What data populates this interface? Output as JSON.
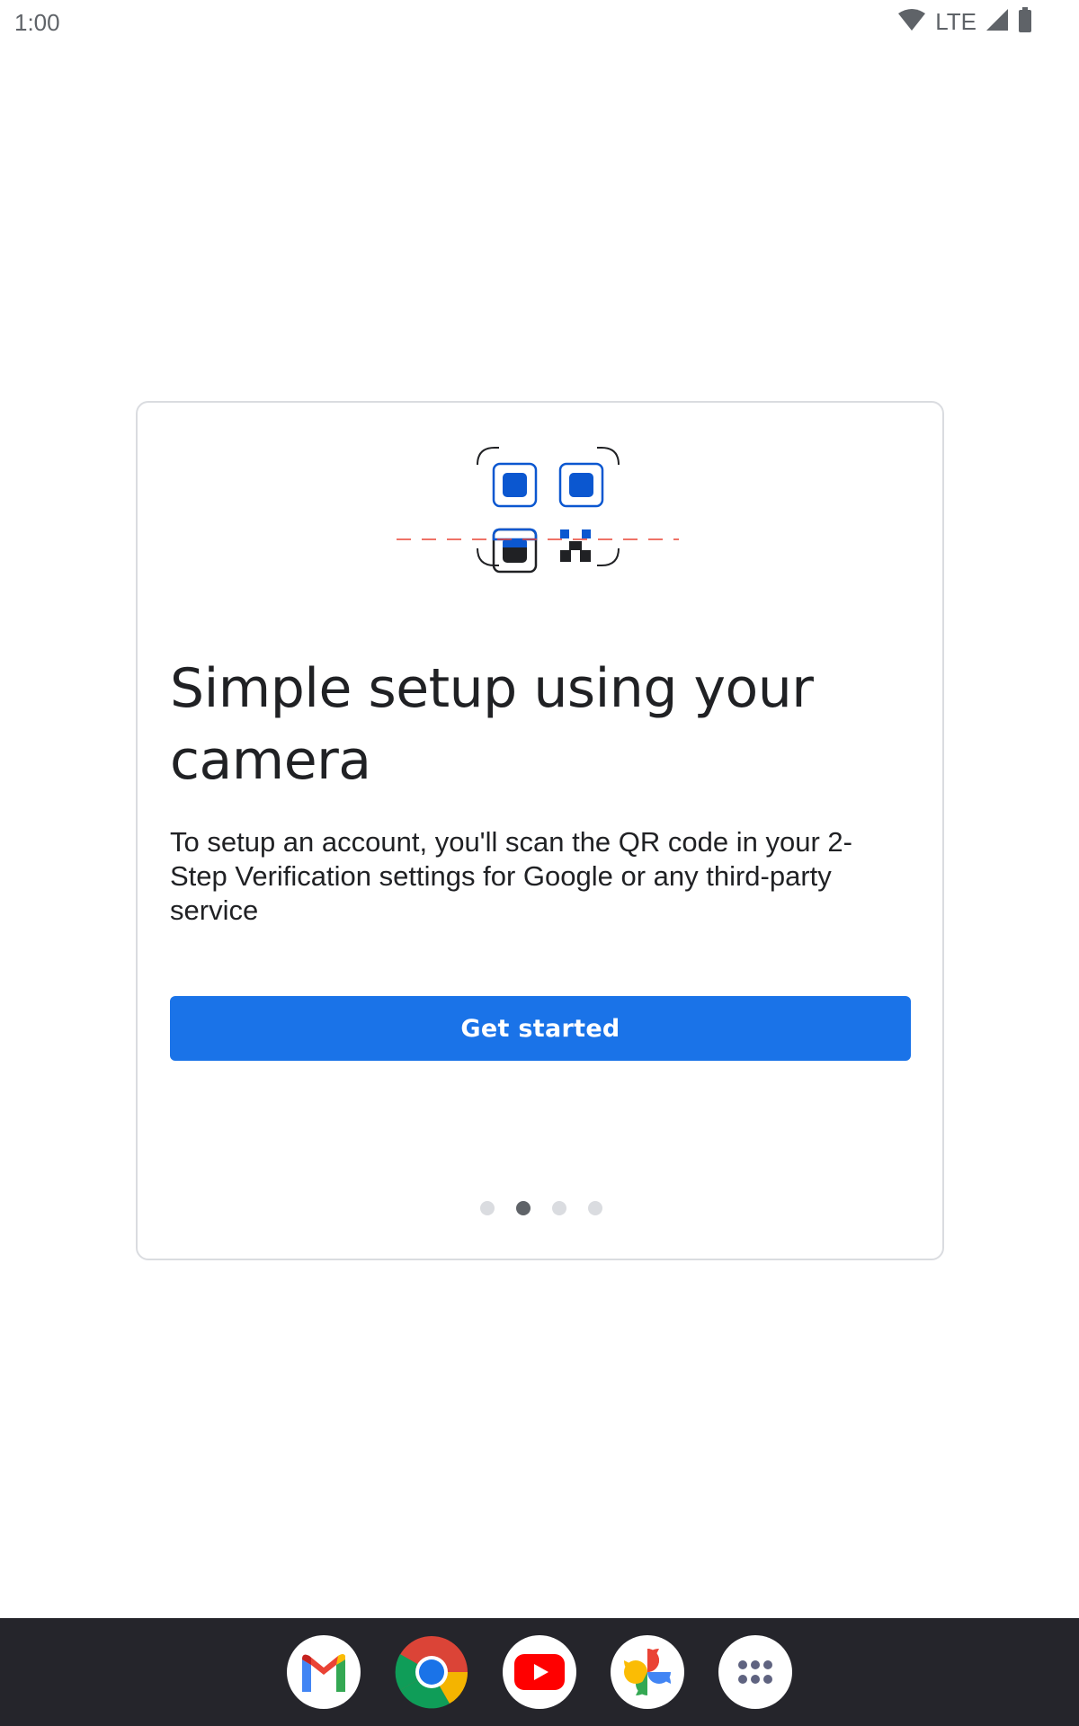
{
  "status_bar": {
    "time": "1:00",
    "network": "LTE",
    "icons": [
      "wifi-icon",
      "cellular-signal-icon",
      "battery-icon"
    ]
  },
  "onboarding": {
    "illustration": "qr-code-scan-illustration",
    "title": "Simple setup using your camera",
    "body": "To setup an account, you'll scan the QR code in your 2-Step Verification settings for Google or any third-party service",
    "button_label": "Get started",
    "page_indicator": {
      "total": 4,
      "current": 2
    }
  },
  "dock": {
    "apps": [
      "gmail-icon",
      "chrome-icon",
      "youtube-icon",
      "photos-icon",
      "app-drawer-icon"
    ]
  },
  "colors": {
    "accent": "#1a73e8",
    "qr_blue": "#0b57d0",
    "scan_line": "#ea4335",
    "dock_background": "#25252b"
  }
}
